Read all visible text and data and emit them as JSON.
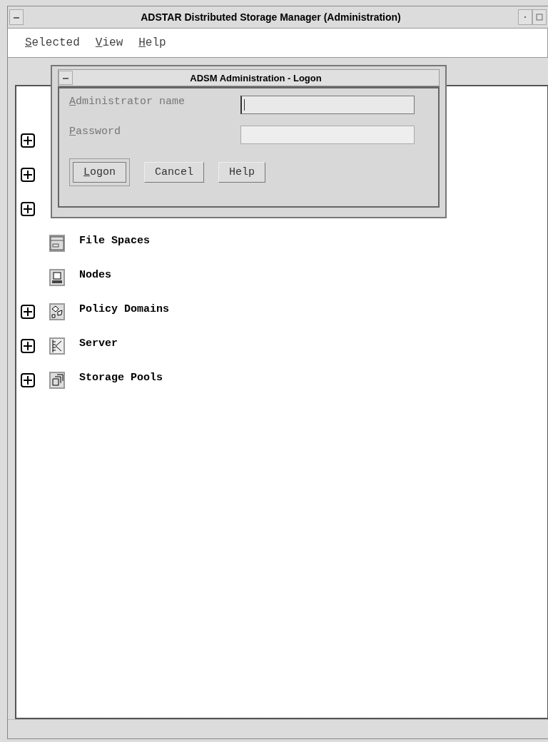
{
  "window": {
    "title": "ADSTAR Distributed Storage Manager (Administration)"
  },
  "menu_bar": [
    {
      "label": "Selected",
      "mnemonic": true
    },
    {
      "label": "View",
      "mnemonic": true
    },
    {
      "label": "Help",
      "mnemonic": true
    }
  ],
  "tree": [
    {
      "expandable": true
    },
    {
      "expandable": true
    },
    {
      "expandable": true
    },
    {
      "label": "File Spaces",
      "expandable": false,
      "kind": "filespaces"
    },
    {
      "label": "Nodes",
      "expandable": false,
      "kind": "nodes"
    },
    {
      "label": "Policy Domains",
      "expandable": true,
      "kind": "policy"
    },
    {
      "label": "Server",
      "expandable": true,
      "kind": "server"
    },
    {
      "label": "Storage Pools",
      "expandable": true,
      "kind": "pools"
    }
  ],
  "dialog": {
    "title": "ADSM Administration - Logon",
    "fields": [
      {
        "label": "Administrator name",
        "mnemonic": true,
        "focused": true
      },
      {
        "label": "Password",
        "mnemonic": true,
        "focused": false
      }
    ],
    "buttons": [
      {
        "label": "Logon",
        "mnemonic": true,
        "default": true
      },
      {
        "label": "Cancel",
        "mnemonic": false,
        "default": false
      },
      {
        "label": "Help",
        "mnemonic": false,
        "default": false
      }
    ]
  }
}
